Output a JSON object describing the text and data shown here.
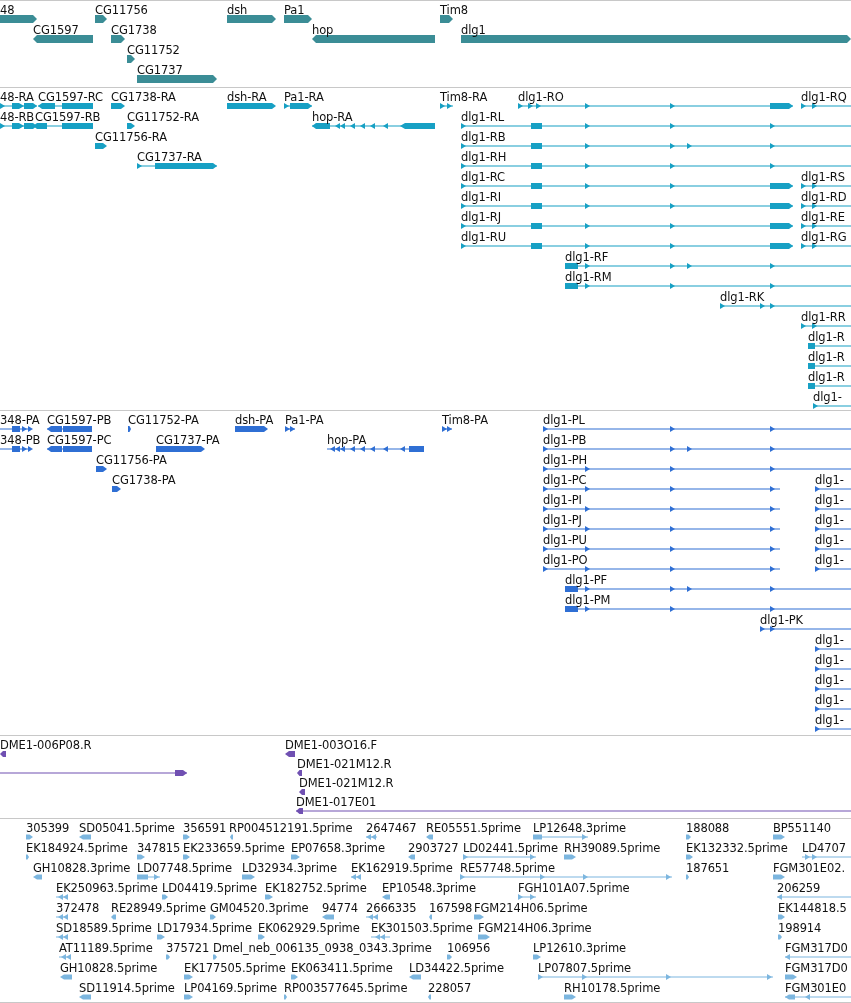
{
  "tracks": [
    {
      "kind": "gene",
      "color": "#3b8d96",
      "features": [
        {
          "label": "48",
          "reverse": false
        },
        {
          "label": "CG11756",
          "reverse": false
        },
        {
          "label": "dsh",
          "reverse": false
        },
        {
          "label": "Pa1",
          "reverse": false
        },
        {
          "label": "Tim8",
          "reverse": false
        },
        {
          "label": "CG1597",
          "reverse": true
        },
        {
          "label": "CG1738",
          "reverse": false
        },
        {
          "label": "hop",
          "reverse": true
        },
        {
          "label": "dlg1",
          "reverse": false
        },
        {
          "label": "CG11752",
          "reverse": false
        },
        {
          "label": "CG1737",
          "reverse": false
        }
      ]
    },
    {
      "kind": "transcript",
      "color": "#17a0c4",
      "features": [
        {
          "label": "48-RA",
          "reverse": false
        },
        {
          "label": "CG1597-RC",
          "reverse": true
        },
        {
          "label": "CG1738-RA",
          "reverse": false
        },
        {
          "label": "dsh-RA",
          "reverse": false
        },
        {
          "label": "Pa1-RA",
          "reverse": false
        },
        {
          "label": "Tim8-RA",
          "reverse": false
        },
        {
          "label": "dlg1-RO",
          "reverse": false
        },
        {
          "label": "dlg1-RQ",
          "reverse": false
        },
        {
          "label": "48-RB",
          "reverse": false
        },
        {
          "label": "CG1597-RB",
          "reverse": true
        },
        {
          "label": "CG11752-RA",
          "reverse": false
        },
        {
          "label": "hop-RA",
          "reverse": true
        },
        {
          "label": "dlg1-RL",
          "reverse": false
        },
        {
          "label": "CG11756-RA",
          "reverse": false
        },
        {
          "label": "dlg1-RB",
          "reverse": false
        },
        {
          "label": "CG1737-RA",
          "reverse": false
        },
        {
          "label": "dlg1-RH",
          "reverse": false
        },
        {
          "label": "dlg1-RC",
          "reverse": false
        },
        {
          "label": "dlg1-RS",
          "reverse": false
        },
        {
          "label": "dlg1-RI",
          "reverse": false
        },
        {
          "label": "dlg1-RD",
          "reverse": false
        },
        {
          "label": "dlg1-RJ",
          "reverse": false
        },
        {
          "label": "dlg1-RE",
          "reverse": false
        },
        {
          "label": "dlg1-RU",
          "reverse": false
        },
        {
          "label": "dlg1-RG",
          "reverse": false
        },
        {
          "label": "dlg1-RF",
          "reverse": false
        },
        {
          "label": "dlg1-RM",
          "reverse": false
        },
        {
          "label": "dlg1-RK",
          "reverse": false
        },
        {
          "label": "dlg1-RR",
          "reverse": false
        },
        {
          "label": "dlg1-R",
          "reverse": false
        },
        {
          "label": "dlg1-R",
          "reverse": false
        },
        {
          "label": "dlg1-R",
          "reverse": false
        },
        {
          "label": "dlg1-",
          "reverse": false
        }
      ]
    },
    {
      "kind": "protein",
      "color": "#2f6fd4",
      "features": [
        {
          "label": "348-PA",
          "reverse": false
        },
        {
          "label": "CG1597-PB",
          "reverse": true
        },
        {
          "label": "CG11752-PA",
          "reverse": false
        },
        {
          "label": "dsh-PA",
          "reverse": false
        },
        {
          "label": "Pa1-PA",
          "reverse": false
        },
        {
          "label": "Tim8-PA",
          "reverse": false
        },
        {
          "label": "dlg1-PL",
          "reverse": false
        },
        {
          "label": "348-PB",
          "reverse": false
        },
        {
          "label": "CG1597-PC",
          "reverse": true
        },
        {
          "label": "CG1737-PA",
          "reverse": false
        },
        {
          "label": "hop-PA",
          "reverse": true
        },
        {
          "label": "dlg1-PB",
          "reverse": false
        },
        {
          "label": "CG11756-PA",
          "reverse": false
        },
        {
          "label": "dlg1-PH",
          "reverse": false
        },
        {
          "label": "CG1738-PA",
          "reverse": false
        },
        {
          "label": "dlg1-PC",
          "reverse": false
        },
        {
          "label": "dlg1-",
          "reverse": false
        },
        {
          "label": "dlg1-PI",
          "reverse": false
        },
        {
          "label": "dlg1-",
          "reverse": false
        },
        {
          "label": "dlg1-PJ",
          "reverse": false
        },
        {
          "label": "dlg1-",
          "reverse": false
        },
        {
          "label": "dlg1-PU",
          "reverse": false
        },
        {
          "label": "dlg1-",
          "reverse": false
        },
        {
          "label": "dlg1-PO",
          "reverse": false
        },
        {
          "label": "dlg1-",
          "reverse": false
        },
        {
          "label": "dlg1-PF",
          "reverse": false
        },
        {
          "label": "dlg1-PM",
          "reverse": false
        },
        {
          "label": "dlg1-PK",
          "reverse": false
        },
        {
          "label": "dlg1-",
          "reverse": false
        },
        {
          "label": "dlg1-",
          "reverse": false
        },
        {
          "label": "dlg1-",
          "reverse": false
        },
        {
          "label": "dlg1-",
          "reverse": false
        },
        {
          "label": "dlg1-",
          "reverse": false
        }
      ]
    },
    {
      "kind": "alignment",
      "color": "#7050b2",
      "features": [
        {
          "label": "DME1-006P08.R",
          "reverse": true
        },
        {
          "label": "DME1-003O16.F",
          "reverse": true
        },
        {
          "reverse": false
        },
        {
          "label": "DME1-021M12.R",
          "reverse": true
        },
        {
          "label": "DME1-021M12.R",
          "reverse": true
        },
        {
          "label": "DME1-017E01",
          "reverse": true
        }
      ]
    },
    {
      "kind": "est",
      "color": "#7cb6df",
      "features": [
        {
          "label": "305399",
          "reverse": false
        },
        {
          "label": "SD05041.5prime",
          "reverse": true
        },
        {
          "label": "356591",
          "reverse": false
        },
        {
          "label": "RP004512191.5prime",
          "reverse": true
        },
        {
          "label": "2647467",
          "reverse": true
        },
        {
          "label": "RE05551.5prime",
          "reverse": true
        },
        {
          "label": "LP12648.3prime",
          "reverse": false
        },
        {
          "label": "188088",
          "reverse": false
        },
        {
          "label": "BP551140",
          "reverse": false
        },
        {
          "label": "EK184924.5prime",
          "reverse": false
        },
        {
          "label": "347815",
          "reverse": false
        },
        {
          "label": "EK233659.5prime",
          "reverse": false
        },
        {
          "label": "EP07658.3prime",
          "reverse": false
        },
        {
          "label": "2903727",
          "reverse": true
        },
        {
          "label": "LD02441.5prime",
          "reverse": false
        },
        {
          "label": "RH39089.5prime",
          "reverse": false
        },
        {
          "label": "EK132332.5prime",
          "reverse": false
        },
        {
          "label": "LD4707",
          "reverse": false
        },
        {
          "label": "GH10828.3prime",
          "reverse": true
        },
        {
          "label": "LD07748.5prime",
          "reverse": false
        },
        {
          "label": "LD32934.3prime",
          "reverse": false
        },
        {
          "label": "EK162919.5prime",
          "reverse": true
        },
        {
          "label": "RE57748.5prime",
          "reverse": false
        },
        {
          "label": "187651",
          "reverse": false
        },
        {
          "label": "FGM301E02.",
          "reverse": false
        },
        {
          "label": "EK250963.5prime",
          "reverse": true
        },
        {
          "label": "LD04419.5prime",
          "reverse": false
        },
        {
          "label": "EK182752.5prime",
          "reverse": false
        },
        {
          "label": "EP10548.3prime",
          "reverse": true
        },
        {
          "label": "FGH101A07.5prime",
          "reverse": false
        },
        {
          "label": "206259",
          "reverse": true
        },
        {
          "label": "372478",
          "reverse": true
        },
        {
          "label": "RE28949.5prime",
          "reverse": true
        },
        {
          "label": "GM04520.3prime",
          "reverse": false
        },
        {
          "label": "94774",
          "reverse": true
        },
        {
          "label": "2666335",
          "reverse": true
        },
        {
          "label": "167598",
          "reverse": true
        },
        {
          "label": "FGM214H06.5prime",
          "reverse": false
        },
        {
          "label": "EK144818.5",
          "reverse": false
        },
        {
          "label": "SD18589.5prime",
          "reverse": true
        },
        {
          "label": "LD17934.5prime",
          "reverse": false
        },
        {
          "label": "EK062929.5prime",
          "reverse": false
        },
        {
          "label": "EK301503.5prime",
          "reverse": true
        },
        {
          "label": "FGM214H06.3prime",
          "reverse": false
        },
        {
          "label": "198914",
          "reverse": false
        },
        {
          "label": "AT11189.5prime",
          "reverse": true
        },
        {
          "label": "375721",
          "reverse": false
        },
        {
          "label": "Dmel_neb_006135_0938_0343.3prime",
          "reverse": false
        },
        {
          "label": "106956",
          "reverse": false
        },
        {
          "label": "LP12610.3prime",
          "reverse": false
        },
        {
          "label": "FGM317D0",
          "reverse": true
        },
        {
          "label": "GH10828.5prime",
          "reverse": true
        },
        {
          "label": "EK177505.5prime",
          "reverse": false
        },
        {
          "label": "EK063411.5prime",
          "reverse": false
        },
        {
          "label": "LD34422.5prime",
          "reverse": true
        },
        {
          "label": "LP07807.5prime",
          "reverse": false
        },
        {
          "label": "FGM317D0",
          "reverse": false
        },
        {
          "label": "SD11914.5prime",
          "reverse": true
        },
        {
          "label": "LP04169.5prime",
          "reverse": false
        },
        {
          "label": "RP003577645.5prime",
          "reverse": false
        },
        {
          "label": "228057",
          "reverse": true
        },
        {
          "label": "RH10178.5prime",
          "reverse": false
        },
        {
          "label": "FGM301E0",
          "reverse": true
        }
      ]
    }
  ]
}
